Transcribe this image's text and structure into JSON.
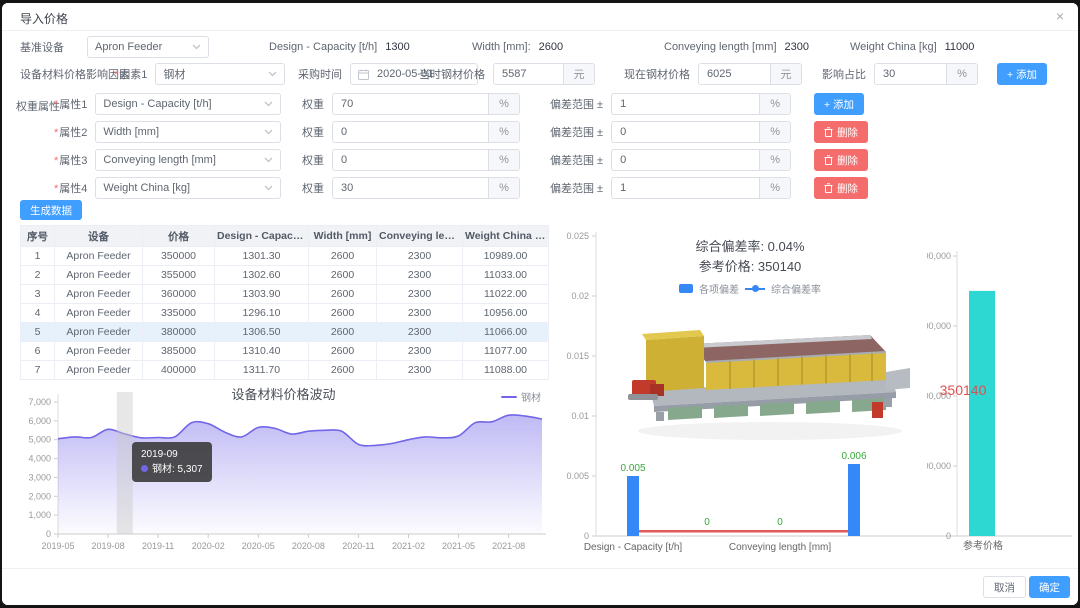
{
  "dialog": {
    "title": "导入价格",
    "close_icon": "×"
  },
  "base_row": {
    "label": "基准设备",
    "equipment": "Apron Feeder",
    "params": [
      {
        "label": "Design - Capacity [t/h]",
        "value": "1300"
      },
      {
        "label": "Width [mm]:",
        "value": "2600"
      },
      {
        "label": "Conveying length [mm]",
        "value": "2300"
      },
      {
        "label": "Weight China [kg]",
        "value": "11000"
      }
    ]
  },
  "factor_row": {
    "section_label": "设备材料价格影响因素",
    "required_mark": "*",
    "factor_label": "因素1",
    "factor_value": "钢材",
    "time_label": "采购时间",
    "time_value": "2020-05-01",
    "then_label": "当时钢材价格",
    "then_value": "5587",
    "now_label": "现在钢材价格",
    "now_value": "6025",
    "ratio_label": "影响占比",
    "ratio_value": "30",
    "unit_yuan": "元",
    "unit_percent": "%",
    "add_button": "+ 添加"
  },
  "weight_section": {
    "section_label": "权重属性",
    "required_mark": "*",
    "weight_label": "权重",
    "deviation_label": "偏差范围 ±",
    "unit_percent": "%",
    "add_button": "+ 添加",
    "delete_button": "删除",
    "rows": [
      {
        "attr_label": "属性1",
        "attr_value": "Design - Capacity [t/h]",
        "weight": "70",
        "deviation": "1",
        "action": "add"
      },
      {
        "attr_label": "属性2",
        "attr_value": "Width [mm]",
        "weight": "0",
        "deviation": "0",
        "action": "delete"
      },
      {
        "attr_label": "属性3",
        "attr_value": "Conveying length [mm]",
        "weight": "0",
        "deviation": "0",
        "action": "delete"
      },
      {
        "attr_label": "属性4",
        "attr_value": "Weight China [kg]",
        "weight": "30",
        "deviation": "1",
        "action": "delete"
      }
    ]
  },
  "generate_button": "生成数据",
  "table": {
    "headers": [
      "序号",
      "设备",
      "价格",
      "Design - Capacity...",
      "Width [mm]",
      "Conveying length...",
      "Weight China [kg]"
    ],
    "rows": [
      [
        "1",
        "Apron Feeder",
        "350000",
        "1301.30",
        "2600",
        "2300",
        "10989.00"
      ],
      [
        "2",
        "Apron Feeder",
        "355000",
        "1302.60",
        "2600",
        "2300",
        "11033.00"
      ],
      [
        "3",
        "Apron Feeder",
        "360000",
        "1303.90",
        "2600",
        "2300",
        "11022.00"
      ],
      [
        "4",
        "Apron Feeder",
        "335000",
        "1296.10",
        "2600",
        "2300",
        "10956.00"
      ],
      [
        "5",
        "Apron Feeder",
        "380000",
        "1306.50",
        "2600",
        "2300",
        "11066.00"
      ],
      [
        "6",
        "Apron Feeder",
        "385000",
        "1310.40",
        "2600",
        "2300",
        "11077.00"
      ],
      [
        "7",
        "Apron Feeder",
        "400000",
        "1311.70",
        "2600",
        "2300",
        "11088.00"
      ]
    ],
    "highlighted_row": 4
  },
  "footer": {
    "cancel": "取消",
    "confirm": "确定"
  },
  "colors": {
    "accent": "#409eff",
    "danger": "#f56c6c",
    "steel_line": "#7266e8",
    "dev_bar": "#3688f7",
    "dev_line": "#e05a5a",
    "dev_label": "#3aa83a",
    "price_bar": "#2ed8d2",
    "price_label": "#e04f4f"
  },
  "chart_data": [
    {
      "type": "area",
      "title": "设备材料价格波动",
      "legend": "钢材",
      "x": [
        "2019-05",
        "2019-06",
        "2019-07",
        "2019-08",
        "2019-09",
        "2019-10",
        "2019-11",
        "2019-12",
        "2020-01",
        "2020-02",
        "2020-03",
        "2020-04",
        "2020-05",
        "2020-06",
        "2020-07",
        "2020-08",
        "2020-09",
        "2020-10",
        "2020-11",
        "2020-12",
        "2021-01",
        "2021-02",
        "2021-03",
        "2021-04",
        "2021-05",
        "2021-06",
        "2021-07",
        "2021-08",
        "2021-09",
        "2021-10"
      ],
      "series": [
        {
          "name": "钢材",
          "values": [
            5050,
            5150,
            5120,
            5550,
            5307,
            5100,
            5120,
            5150,
            5900,
            5850,
            5400,
            5150,
            5650,
            5600,
            5300,
            5450,
            5500,
            5450,
            4750,
            4700,
            4800,
            5000,
            5150,
            5100,
            5200,
            5900,
            5950,
            6300,
            6250,
            6100
          ]
        }
      ],
      "ylim": [
        0,
        7000
      ],
      "ytick_step": 1000,
      "xtick_indices": [
        0,
        3,
        6,
        9,
        12,
        15,
        18,
        21,
        24,
        27
      ],
      "highlight_index": 4,
      "tooltip": {
        "title": "2019-09",
        "text": "钢材: 5,307"
      }
    },
    {
      "type": "bar",
      "summary_line1": "综合偏差率: 0.04%",
      "summary_line2": "参考价格: 350140",
      "legend": [
        {
          "label": "各项偏差",
          "type": "bar"
        },
        {
          "label": "综合偏差率",
          "type": "line"
        }
      ],
      "categories": [
        "Design - Capacity [t/h]",
        "Width [mm]",
        "Conveying length [mm]",
        "Weight China [kg]"
      ],
      "values": [
        0.005,
        0,
        0,
        0.006
      ],
      "value_labels": [
        "0.005",
        "0",
        "0",
        "0.006"
      ],
      "line_name": "综合偏差率",
      "line_value": 0.0004,
      "ylim": [
        0,
        0.025
      ],
      "ytick_step": 0.005,
      "xtick_indices": [
        0,
        2
      ]
    },
    {
      "type": "bar",
      "categories": [
        "参考价格"
      ],
      "values": [
        350140
      ],
      "value_label": "350140",
      "ylim": [
        0,
        400000
      ],
      "ytick_step": 100000
    }
  ]
}
